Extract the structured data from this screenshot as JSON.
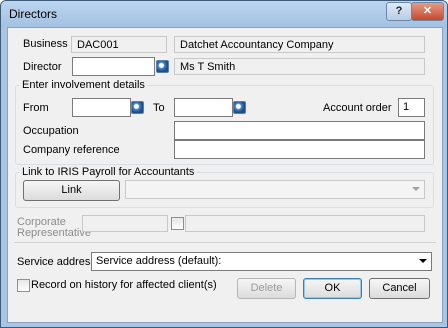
{
  "window": {
    "title": "Directors",
    "help_label": "?",
    "close_label": "✕"
  },
  "business": {
    "label": "Business",
    "code": "DAC001",
    "name": "Datchet Accountancy Company"
  },
  "director": {
    "label": "Director",
    "value": "",
    "name": "Ms T Smith"
  },
  "involvement": {
    "title": "Enter involvement details",
    "from_label": "From",
    "from_value": "",
    "to_label": "To",
    "to_value": "",
    "account_order_label": "Account order",
    "account_order_value": "1",
    "occupation_label": "Occupation",
    "occupation_value": "",
    "company_reference_label": "Company reference",
    "company_reference_value": ""
  },
  "iris": {
    "title": "Link to IRIS Payroll for Accountants",
    "link_label": "Link",
    "select_value": ""
  },
  "corporate": {
    "label_line1": "Corporate",
    "label_line2": "Representative",
    "value": "",
    "name": ""
  },
  "service_address": {
    "label": "Service address",
    "selected": "Service address (default):"
  },
  "record_history": {
    "label": "Record on history for affected client(s)",
    "checked": false
  },
  "buttons": {
    "delete": "Delete",
    "ok": "OK",
    "cancel": "Cancel"
  }
}
